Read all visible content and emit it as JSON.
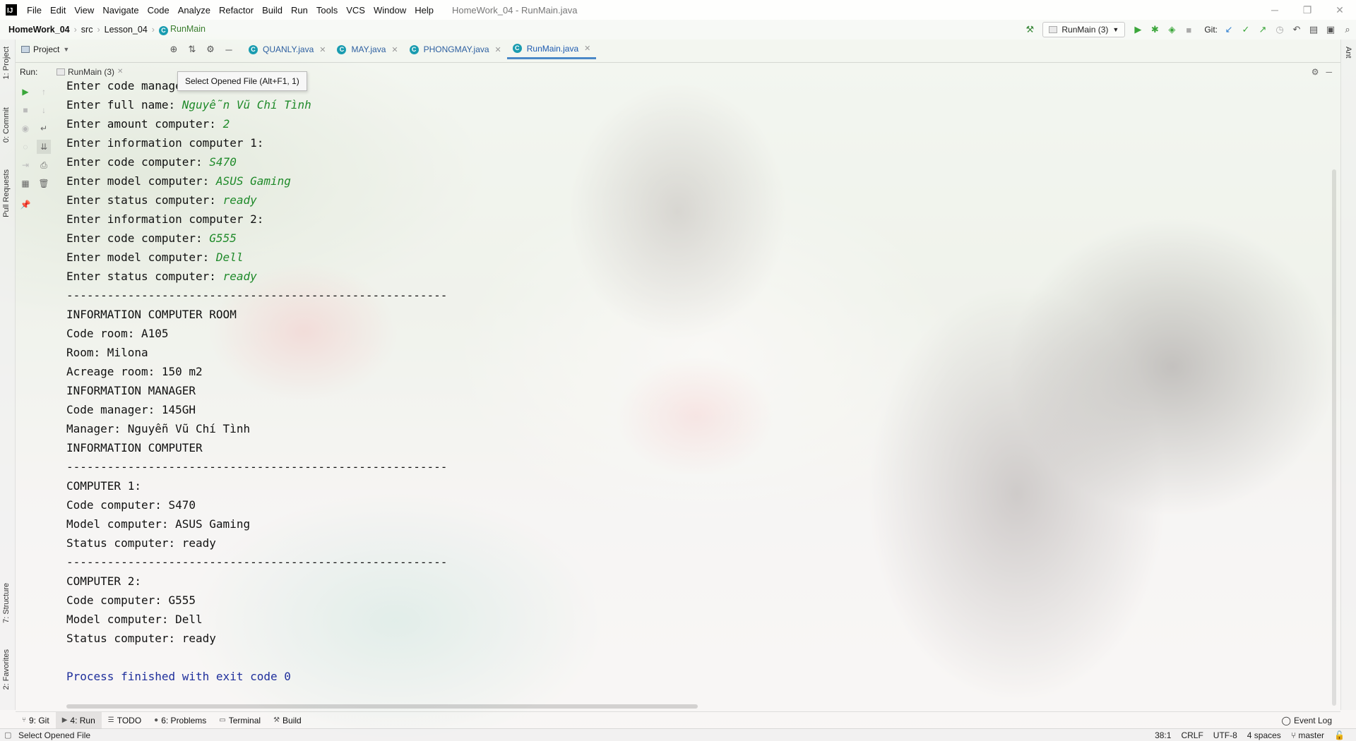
{
  "menubar": {
    "items": [
      "File",
      "Edit",
      "View",
      "Navigate",
      "Code",
      "Analyze",
      "Refactor",
      "Build",
      "Run",
      "Tools",
      "VCS",
      "Window",
      "Help"
    ],
    "window_title": "HomeWork_04 - RunMain.java"
  },
  "breadcrumb": {
    "project": "HomeWork_04",
    "src": "src",
    "package": "Lesson_04",
    "class": "RunMain"
  },
  "toolbar": {
    "run_config": "RunMain (3)",
    "git_label": "Git:"
  },
  "tool_windows": {
    "project_label": "Project",
    "left": [
      "1: Project",
      "0: Commit",
      "Pull Requests",
      "7: Structure",
      "2: Favorites"
    ],
    "right": [
      "Ant"
    ]
  },
  "editor_tabs": [
    {
      "label": "QUANLY.java",
      "active": false
    },
    {
      "label": "MAY.java",
      "active": false
    },
    {
      "label": "PHONGMAY.java",
      "active": false
    },
    {
      "label": "RunMain.java",
      "active": true
    }
  ],
  "run_panel": {
    "label": "Run:",
    "tab": "RunMain (3)",
    "tooltip": "Select Opened File (Alt+F1, 1)"
  },
  "console": {
    "lines": [
      {
        "prefix": "Enter code manager: ",
        "input": ""
      },
      {
        "prefix": "Enter full name: ",
        "input": "Nguyễn Vũ Chí Tình"
      },
      {
        "prefix": "Enter amount computer: ",
        "input": "2"
      },
      {
        "prefix": "Enter information computer 1:",
        "input": ""
      },
      {
        "prefix": "Enter code computer: ",
        "input": "S470"
      },
      {
        "prefix": "Enter model computer: ",
        "input": "ASUS Gaming"
      },
      {
        "prefix": "Enter status computer: ",
        "input": "ready"
      },
      {
        "prefix": "Enter information computer 2:",
        "input": ""
      },
      {
        "prefix": "Enter code computer: ",
        "input": "G555"
      },
      {
        "prefix": "Enter model computer: ",
        "input": "Dell"
      },
      {
        "prefix": "Enter status computer: ",
        "input": "ready"
      },
      {
        "prefix": "--------------------------------------------------------",
        "input": ""
      },
      {
        "prefix": "INFORMATION COMPUTER ROOM",
        "input": ""
      },
      {
        "prefix": "Code room: A105",
        "input": ""
      },
      {
        "prefix": "Room: Milona",
        "input": ""
      },
      {
        "prefix": "Acreage room: 150 m2",
        "input": ""
      },
      {
        "prefix": "INFORMATION MANAGER",
        "input": ""
      },
      {
        "prefix": "Code manager: 145GH",
        "input": ""
      },
      {
        "prefix": "Manager: Nguyễn Vũ Chí Tình",
        "input": ""
      },
      {
        "prefix": "INFORMATION COMPUTER",
        "input": ""
      },
      {
        "prefix": "--------------------------------------------------------",
        "input": ""
      },
      {
        "prefix": "COMPUTER 1:",
        "input": ""
      },
      {
        "prefix": "Code computer: S470",
        "input": ""
      },
      {
        "prefix": "Model computer: ASUS Gaming",
        "input": ""
      },
      {
        "prefix": "Status computer: ready",
        "input": ""
      },
      {
        "prefix": "--------------------------------------------------------",
        "input": ""
      },
      {
        "prefix": "COMPUTER 2:",
        "input": ""
      },
      {
        "prefix": "Code computer: G555",
        "input": ""
      },
      {
        "prefix": "Model computer: Dell",
        "input": ""
      },
      {
        "prefix": "Status computer: ready",
        "input": ""
      },
      {
        "prefix": "",
        "input": ""
      }
    ],
    "exit_message": "Process finished with exit code 0"
  },
  "bottom_tools": [
    {
      "label": "9: Git",
      "icon": "git-icon",
      "active": false
    },
    {
      "label": "4: Run",
      "icon": "run-icon",
      "active": true
    },
    {
      "label": "TODO",
      "icon": "todo-icon",
      "active": false
    },
    {
      "label": "6: Problems",
      "icon": "problems-icon",
      "active": false
    },
    {
      "label": "Terminal",
      "icon": "terminal-icon",
      "active": false
    },
    {
      "label": "Build",
      "icon": "build-icon",
      "active": false
    }
  ],
  "event_log": "Event Log",
  "statusbar": {
    "message": "Select Opened File",
    "position": "38:1",
    "line_sep": "CRLF",
    "encoding": "UTF-8",
    "indent": "4 spaces",
    "branch": "master"
  },
  "colors": {
    "input_text": "#1f8a2a",
    "exit_text": "#1f2f9c",
    "active_tab": "#4a88c7"
  }
}
